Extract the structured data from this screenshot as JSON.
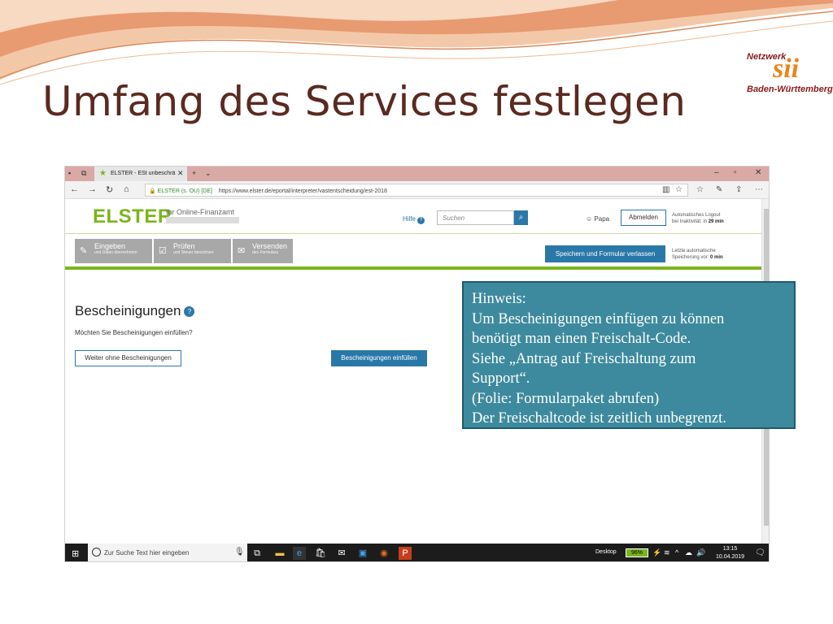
{
  "slide": {
    "title": "Umfang des Services festlegen",
    "logo": {
      "line1": "Netzwerk",
      "mark": "sii",
      "line2": "Baden-Württemberg"
    }
  },
  "browser": {
    "tab_title": "ELSTER - ESt unbeschrä",
    "site_label": "ELSTER (s. OU) [DE]",
    "url": "https://www.elster.de/eportal/interpreter/vastentscheidung/est-2018"
  },
  "elster": {
    "logo_text": "ELSTER",
    "subtitle": "Ihr Online-Finanzamt",
    "help_label": "Hilfe",
    "search_placeholder": "Suchen",
    "user_label": "Papa",
    "logout_label": "Abmelden",
    "logout_info_line1": "Automatisches Logout",
    "logout_info_line2": "bei Inaktivität: in",
    "logout_info_time": "29 min",
    "steps": [
      {
        "title": "Eingeben",
        "subtitle": "und Daten übernehmen"
      },
      {
        "title": "Prüfen",
        "subtitle": "und Steuer berechnen"
      },
      {
        "title": "Versenden",
        "subtitle": "des Formulars"
      }
    ],
    "save_label": "Speichern und Formular verlassen",
    "save_info_line1": "Letzte automatische",
    "save_info_line2": "Speicherung vor:",
    "save_info_time": "0 min",
    "section_title": "Bescheinigungen",
    "section_question": "Möchten Sie Bescheinigungen einfüllen?",
    "continue_label": "Weiter ohne Bescheinigungen",
    "fill_label": "Bescheinigungen einfüllen"
  },
  "taskbar": {
    "search_placeholder": "Zur Suche Text hier eingeben",
    "desktop_label": "Desktop",
    "battery": "96%",
    "time": "13:15",
    "date": "10.04.2019"
  },
  "callout": {
    "lines": [
      "Hinweis:",
      "Um Bescheinigungen einfügen zu können",
      "benötigt man einen Freischalt-Code.",
      "Siehe „Antrag auf Freischaltung zum",
      "Support“.",
      "(Folie: Formularpaket abrufen)",
      "Der Freischaltcode ist zeitlich unbegrenzt."
    ]
  },
  "colors": {
    "title": "#5a2a20",
    "elster_green": "#7ab51d",
    "elster_blue": "#2a78a8",
    "callout_bg": "#3d8a9e"
  }
}
